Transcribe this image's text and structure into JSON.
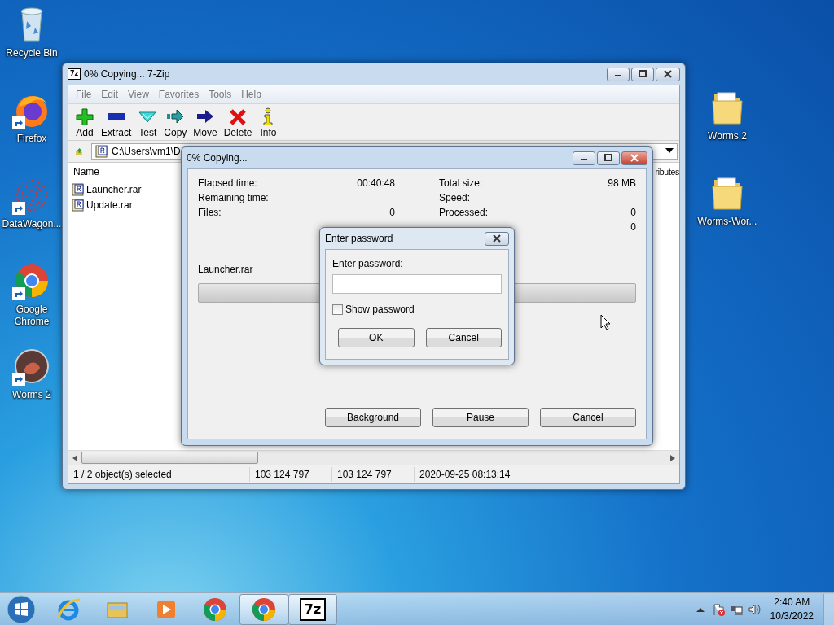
{
  "desktop_icons_left": [
    {
      "label": "Recycle Bin",
      "kind": "recycle",
      "shortcut": false
    },
    {
      "label": "Firefox",
      "kind": "firefox",
      "shortcut": true
    },
    {
      "label": "DataWagon...",
      "kind": "datawagon",
      "shortcut": true
    },
    {
      "label": "Google Chrome",
      "kind": "chrome",
      "shortcut": true
    },
    {
      "label": "Worms 2",
      "kind": "worms",
      "shortcut": true
    }
  ],
  "desktop_icons_right": [
    {
      "label": "Worms.2",
      "kind": "folder",
      "shortcut": false
    },
    {
      "label": "Worms-Wor...",
      "kind": "folder",
      "shortcut": false
    }
  ],
  "main_window": {
    "icon_text": "7z",
    "title": "0% Copying... 7-Zip",
    "menu": [
      "File",
      "Edit",
      "View",
      "Favorites",
      "Tools",
      "Help"
    ],
    "toolbar": [
      {
        "label": "Add",
        "kind": "add"
      },
      {
        "label": "Extract",
        "kind": "extract"
      },
      {
        "label": "Test",
        "kind": "test"
      },
      {
        "label": "Copy",
        "kind": "copy"
      },
      {
        "label": "Move",
        "kind": "move"
      },
      {
        "label": "Delete",
        "kind": "delete"
      },
      {
        "label": "Info",
        "kind": "info"
      }
    ],
    "address": "C:\\Users\\vm1\\D",
    "columns": [
      "Name",
      "ributes"
    ],
    "files": [
      "Launcher.rar",
      "Update.rar"
    ],
    "status_bar": [
      "1 / 2 object(s) selected",
      "103 124 797",
      "103 124 797",
      "2020-09-25 08:13:14"
    ]
  },
  "copy_dialog": {
    "title": "0% Copying...",
    "stats_left": [
      {
        "label": "Elapsed time:",
        "value": "00:40:48"
      },
      {
        "label": "Remaining time:"
      },
      {
        "label": "Files:",
        "value": "0"
      }
    ],
    "stats_right": [
      {
        "label": "Total size:",
        "value": "98 MB"
      },
      {
        "label": "Speed:"
      },
      {
        "label": "Processed:",
        "value": "0"
      },
      {
        "value": "0"
      }
    ],
    "current_file": "Launcher.rar",
    "progress": {
      "level": 0
    },
    "buttons": [
      "Background",
      "Pause",
      "Cancel"
    ]
  },
  "password_dialog": {
    "title": "Enter password",
    "field_label": "Enter password:",
    "show_password": {
      "label": "Show password",
      "checked": false
    },
    "buttons": [
      "OK",
      "Cancel"
    ]
  },
  "taskbar": {
    "items": [
      {
        "kind": "ie",
        "active": false
      },
      {
        "kind": "explorer",
        "active": false
      },
      {
        "kind": "media",
        "active": false
      },
      {
        "kind": "chrome",
        "active": false
      },
      {
        "kind": "chrome",
        "active": true
      },
      {
        "kind": "sevenzip",
        "active": true,
        "icon_text": "7z"
      }
    ],
    "clock": {
      "time": "2:40 AM",
      "date": "10/3/2022"
    }
  }
}
